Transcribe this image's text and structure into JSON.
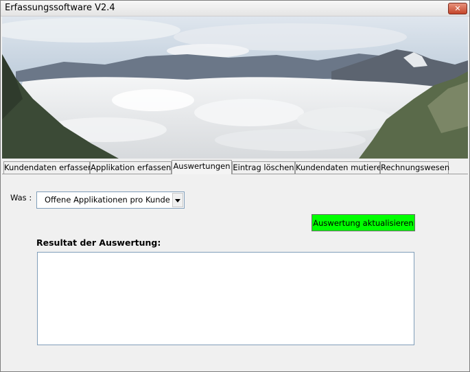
{
  "window": {
    "title": "Erfassungssoftware V2.4",
    "close_label": "✕"
  },
  "tabs": [
    {
      "label": "Kundendaten erfassen",
      "active": false
    },
    {
      "label": "Applikation erfassen",
      "active": false
    },
    {
      "label": "Auswertungen",
      "active": true
    },
    {
      "label": "Eintrag löschen",
      "active": false
    },
    {
      "label": "Kundendaten mutieren",
      "active": false
    },
    {
      "label": "Rechnungswesen",
      "active": false
    }
  ],
  "form": {
    "was_label": "Was :",
    "was_value": "Offene Applikationen pro Kunde",
    "update_button": "Auswertung aktualisieren",
    "result_label": "Resultat der Auswertung:",
    "result_text": ""
  },
  "colors": {
    "update_button": "#00ff00"
  }
}
